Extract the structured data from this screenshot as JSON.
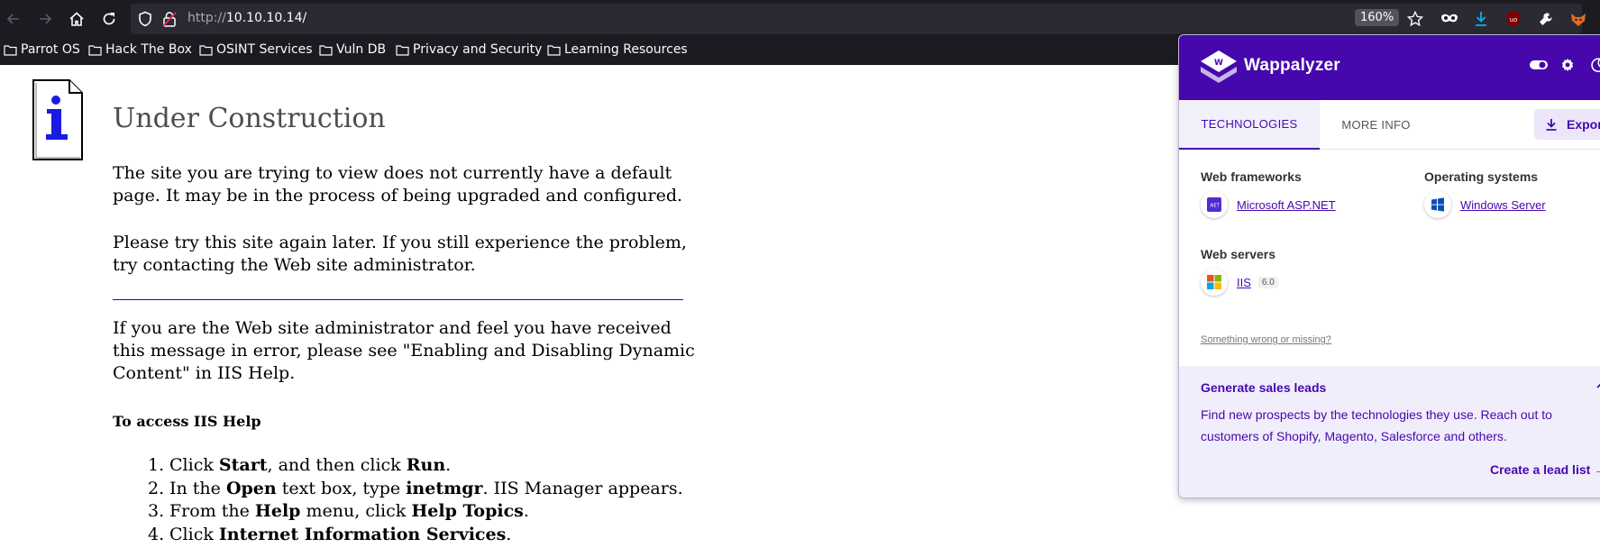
{
  "browser": {
    "url_scheme": "http://",
    "url_host": "10.10.10.14",
    "url_path": "/",
    "zoom": "160%"
  },
  "bookmarks": [
    {
      "label": "Parrot OS"
    },
    {
      "label": "Hack The Box"
    },
    {
      "label": "OSINT Services"
    },
    {
      "label": "Vuln DB"
    },
    {
      "label": "Privacy and Security"
    },
    {
      "label": "Learning Resources"
    }
  ],
  "page": {
    "title": "Under Construction",
    "p1": "The site you are trying to view does not currently have a default page. It may be in the process of being upgraded and configured.",
    "p2": "Please try this site again later. If you still experience the problem, try contacting the Web site administrator.",
    "p3": "If you are the Web site administrator and feel you have received this message in error, please see \"Enabling and Disabling Dynamic Content\" in IIS Help.",
    "help_heading": "To access IIS Help",
    "steps": [
      {
        "num": "1.",
        "a": "Click ",
        "b": "Start",
        "c": ", and then click ",
        "d": "Run",
        "e": "."
      },
      {
        "num": "2.",
        "a": "In the ",
        "b": "Open",
        "c": " text box, type ",
        "d": "inetmgr",
        "e": ". IIS Manager appears."
      },
      {
        "num": "3.",
        "a": "From the ",
        "b": "Help",
        "c": " menu, click ",
        "d": "Help Topics",
        "e": "."
      },
      {
        "num": "4.",
        "a": "Click ",
        "b": "Internet Information Services",
        "c": "",
        "d": "",
        "e": "."
      }
    ]
  },
  "wappalyzer": {
    "title": "Wappalyzer",
    "tabs": {
      "technologies": "TECHNOLOGIES",
      "more_info": "MORE INFO"
    },
    "export_label": "Export",
    "categories": {
      "web_frameworks": {
        "title": "Web frameworks",
        "tech": "Microsoft ASP.NET",
        "icon_text": ".NET"
      },
      "operating_systems": {
        "title": "Operating systems",
        "tech": "Windows Server"
      },
      "web_servers": {
        "title": "Web servers",
        "tech": "IIS",
        "version": "6.0"
      }
    },
    "wrong_link": "Something wrong or missing?",
    "leads": {
      "title": "Generate sales leads",
      "text": "Find new prospects by the technologies they use. Reach out to customers of Shopify, Magento, Salesforce and others.",
      "cta": "Create a lead list →"
    },
    "colors": {
      "brand": "#4608ad",
      "leads_bg": "#f1eefb"
    }
  }
}
